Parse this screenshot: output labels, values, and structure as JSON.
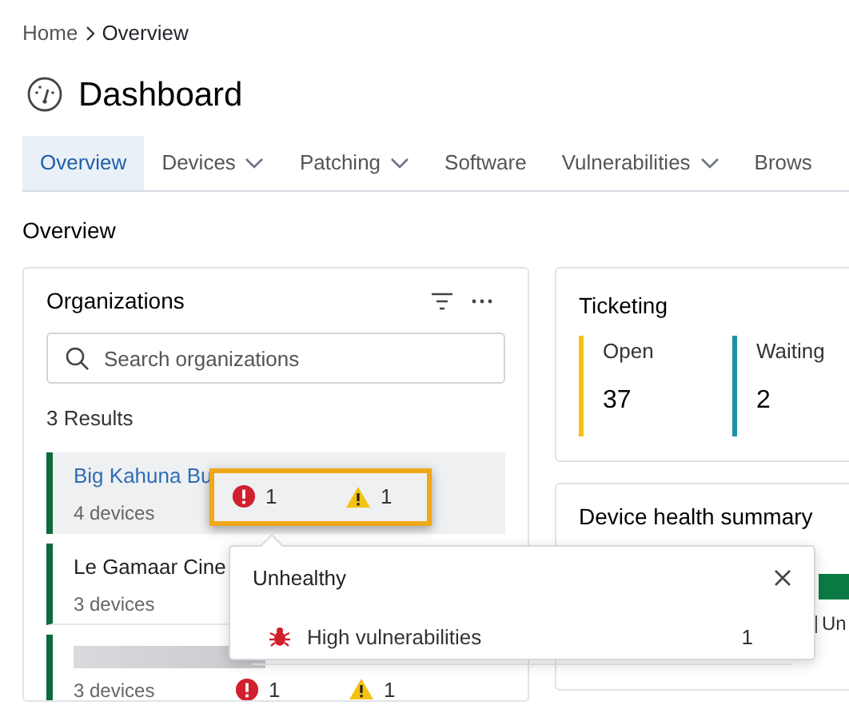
{
  "breadcrumb": [
    {
      "label": "Home"
    },
    {
      "label": "Overview"
    }
  ],
  "page_title": "Dashboard",
  "tabs": [
    {
      "label": "Overview",
      "selected": true,
      "dropdown": false
    },
    {
      "label": "Devices",
      "selected": false,
      "dropdown": true
    },
    {
      "label": "Patching",
      "selected": false,
      "dropdown": true
    },
    {
      "label": "Software",
      "selected": false,
      "dropdown": false
    },
    {
      "label": "Vulnerabilities",
      "selected": false,
      "dropdown": true
    },
    {
      "label": "Brows",
      "selected": false,
      "dropdown": false
    }
  ],
  "section_title": "Overview",
  "organizations": {
    "title": "Organizations",
    "search": {
      "placeholder": "Search organizations"
    },
    "results": "3 Results",
    "rows": [
      {
        "name": "Big Kahuna Bu",
        "devices": "4 devices",
        "selected": true,
        "errors": "1",
        "warnings": "1"
      },
      {
        "name": "Le Gamaar Cine",
        "devices": "3 devices",
        "selected": false
      },
      {
        "name": "",
        "devices": "3 devices",
        "selected": false,
        "errors": "1",
        "warnings": "1"
      }
    ]
  },
  "popover": {
    "title": "Unhealthy",
    "items": [
      {
        "label": "High vulnerabilities",
        "count": "1"
      }
    ]
  },
  "ticketing": {
    "title": "Ticketing",
    "stats": [
      {
        "label": "Open",
        "value": "37",
        "color": "#f5c211"
      },
      {
        "label": "Waiting",
        "value": "2",
        "color": "#1a94a3"
      }
    ]
  },
  "device_health": {
    "title": "Device health summary",
    "legend": "Un"
  }
}
